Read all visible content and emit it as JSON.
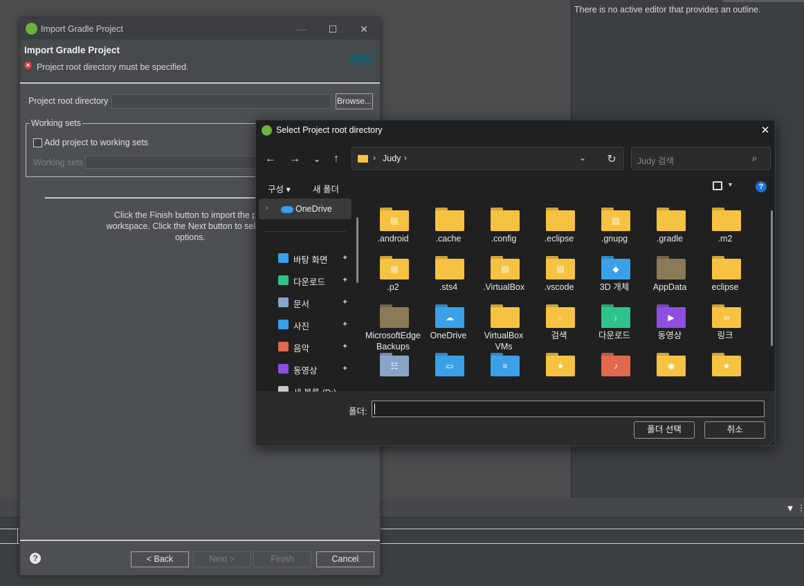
{
  "ide": {
    "outline_message": "There is no active editor that provides an outline."
  },
  "gradle_dialog": {
    "window_title": "Import Gradle Project",
    "heading": "Import Gradle Project",
    "error_message": "Project root directory must be specified.",
    "root_dir_label": "Project root directory",
    "root_dir_value": "",
    "browse_label": "Browse...",
    "working_sets_legend": "Working sets",
    "add_to_working_sets_label": "Add project to working sets",
    "add_to_working_sets_checked": false,
    "working_sets_label": "Working sets",
    "info_text": "Click the Finish button to import the proj\nworkspace. Click the Next button to select o\noptions.",
    "help_icon": "help-icon",
    "buttons": {
      "back": "< Back",
      "next": "Next >",
      "finish": "Finish",
      "cancel": "Cancel"
    },
    "window_controls": {
      "minimize": "—",
      "maximize": "☐",
      "close": "✕"
    }
  },
  "picker": {
    "title": "Select Project root directory",
    "close": "✕",
    "nav_back": "←",
    "nav_forward": "→",
    "nav_recent": "⌄",
    "nav_up": "↑",
    "address_sep": "›",
    "address_path": "Judy",
    "address_dropdown": "⌄",
    "refresh": "↻",
    "search_placeholder": "Judy 검색",
    "search_icon": "⌕",
    "organize_label": "구성 ▾",
    "new_folder_label": "새 폴더",
    "view_caret": "▾",
    "help": "?",
    "nav_pane": {
      "chevron": "›",
      "onedrive_label": "OneDrive",
      "items": [
        {
          "label": "바탕 화면",
          "icon": "desktop-icon",
          "color": "#3aa0e8",
          "pinned": true
        },
        {
          "label": "다운로드",
          "icon": "download-icon",
          "color": "#2fc28b",
          "pinned": true
        },
        {
          "label": "문서",
          "icon": "document-icon",
          "color": "#8aa4c8",
          "pinned": true
        },
        {
          "label": "사진",
          "icon": "pictures-icon",
          "color": "#3aa0e8",
          "pinned": true
        },
        {
          "label": "음악",
          "icon": "music-icon",
          "color": "#e0694e",
          "pinned": true
        },
        {
          "label": "동영상",
          "icon": "videos-icon",
          "color": "#8e4ee0",
          "pinned": true
        },
        {
          "label": "새 볼륨 (D:)",
          "icon": "drive-icon",
          "color": "#c8c8c8",
          "pinned": false
        }
      ],
      "pin_glyph": "📌"
    },
    "folders": [
      {
        "label": ".android",
        "kind": "doc",
        "color": "#f5c242"
      },
      {
        "label": ".cache",
        "kind": "plain",
        "color": "#f5c242"
      },
      {
        "label": ".config",
        "kind": "plain",
        "color": "#f5c242"
      },
      {
        "label": ".eclipse",
        "kind": "plain",
        "color": "#f5c242"
      },
      {
        "label": ".gnupg",
        "kind": "doc",
        "color": "#f5c242"
      },
      {
        "label": ".gradle",
        "kind": "plain",
        "color": "#f5c242"
      },
      {
        "label": ".m2",
        "kind": "plain",
        "color": "#f5c242"
      },
      {
        "label": ".p2",
        "kind": "doc",
        "color": "#f5c242"
      },
      {
        "label": ".sts4",
        "kind": "plain",
        "color": "#f5c242"
      },
      {
        "label": ".VirtualBox",
        "kind": "doc",
        "color": "#f5c242"
      },
      {
        "label": ".vscode",
        "kind": "doc",
        "color": "#f5c242"
      },
      {
        "label": "3D 개체",
        "kind": "3d",
        "color": "#3aa0e8"
      },
      {
        "label": "AppData",
        "kind": "plain",
        "color": "#8a7a55"
      },
      {
        "label": "eclipse",
        "kind": "plain",
        "color": "#f5c242"
      },
      {
        "label": "MicrosoftEdgeBackups",
        "kind": "plain",
        "color": "#8a7a55"
      },
      {
        "label": "OneDrive",
        "kind": "cloud",
        "color": "#3aa0e8"
      },
      {
        "label": "VirtualBox VMs",
        "kind": "plain",
        "color": "#f5c242"
      },
      {
        "label": "검색",
        "kind": "search",
        "color": "#f5c242"
      },
      {
        "label": "다운로드",
        "kind": "download",
        "color": "#2fc28b"
      },
      {
        "label": "동영상",
        "kind": "video",
        "color": "#8e4ee0"
      },
      {
        "label": "링크",
        "kind": "link",
        "color": "#f5c242"
      },
      {
        "label": "",
        "kind": "contacts",
        "color": "#8aa4c8"
      },
      {
        "label": "",
        "kind": "desktop",
        "color": "#3aa0e8"
      },
      {
        "label": "",
        "kind": "documents",
        "color": "#3aa0e8"
      },
      {
        "label": "",
        "kind": "favorites",
        "color": "#f5c242"
      },
      {
        "label": "",
        "kind": "music",
        "color": "#e0694e"
      },
      {
        "label": "",
        "kind": "games",
        "color": "#f5c242"
      },
      {
        "label": "",
        "kind": "star",
        "color": "#f5c242"
      }
    ],
    "folder_field_label": "폴더:",
    "folder_field_value": "",
    "select_button": "폴더 선택",
    "cancel_button": "취소"
  }
}
